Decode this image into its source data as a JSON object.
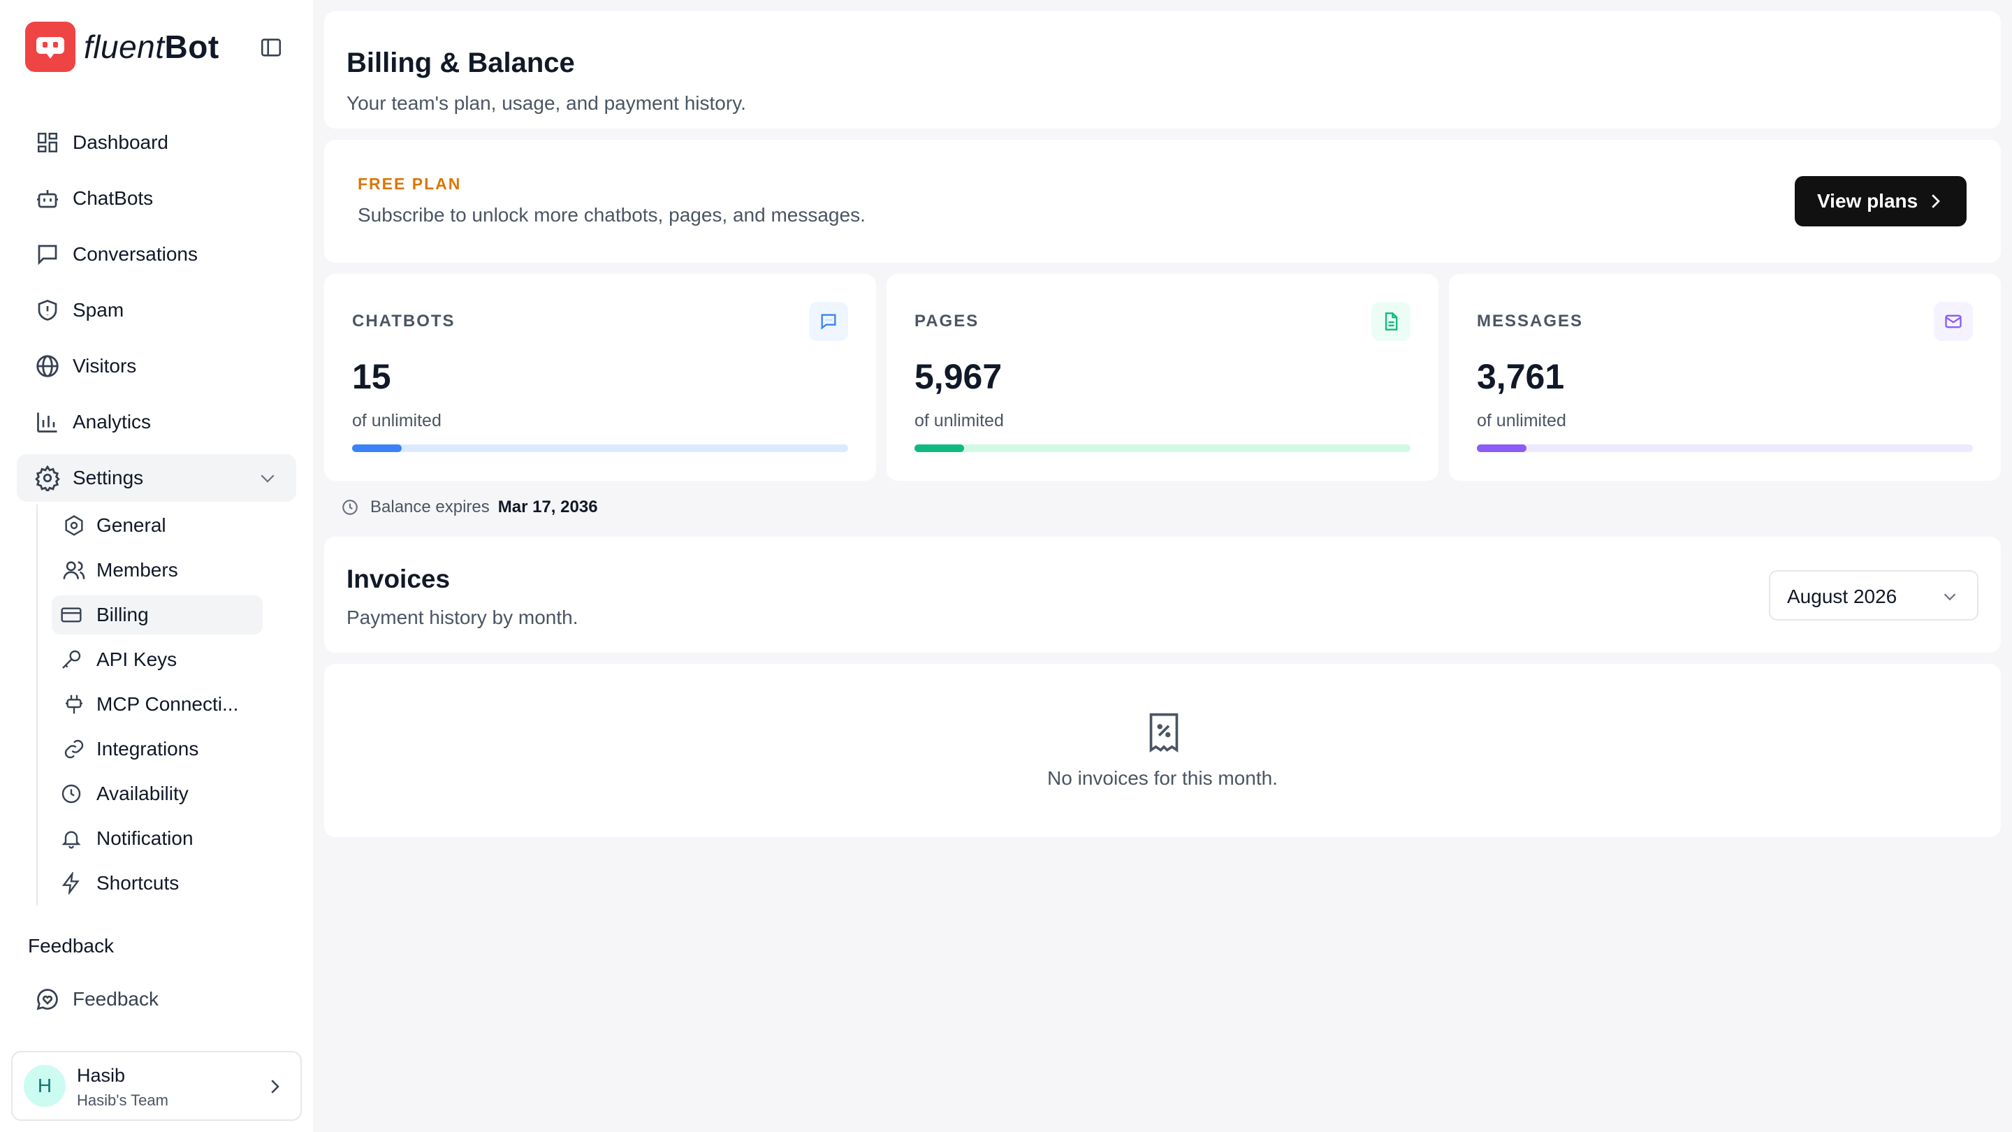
{
  "brand": {
    "name_light": "fluent",
    "name_bold": "Bot"
  },
  "nav": [
    {
      "label": "Dashboard",
      "icon": "dashboard-icon"
    },
    {
      "label": "ChatBots",
      "icon": "bot-icon"
    },
    {
      "label": "Conversations",
      "icon": "chat-bubble-icon"
    },
    {
      "label": "Spam",
      "icon": "shield-alert-icon"
    },
    {
      "label": "Visitors",
      "icon": "globe-icon"
    },
    {
      "label": "Analytics",
      "icon": "bar-chart-icon"
    },
    {
      "label": "Settings",
      "icon": "gear-icon",
      "expanded": true
    }
  ],
  "settings_sub": [
    {
      "label": "General",
      "icon": "hex-settings-icon"
    },
    {
      "label": "Members",
      "icon": "users-icon"
    },
    {
      "label": "Billing",
      "icon": "credit-card-icon",
      "active": true
    },
    {
      "label": "API Keys",
      "icon": "key-icon"
    },
    {
      "label": "MCP Connecti...",
      "icon": "plug-icon"
    },
    {
      "label": "Integrations",
      "icon": "link-icon"
    },
    {
      "label": "Availability",
      "icon": "clock-icon"
    },
    {
      "label": "Notification",
      "icon": "bell-icon"
    },
    {
      "label": "Shortcuts",
      "icon": "bolt-icon"
    }
  ],
  "feedback": {
    "section_title": "Feedback",
    "item_label": "Feedback"
  },
  "user": {
    "initial": "H",
    "name": "Hasib",
    "team": "Hasib's Team"
  },
  "header": {
    "title": "Billing & Balance",
    "subtitle": "Your team's plan, usage, and payment history."
  },
  "plan": {
    "tag": "FREE PLAN",
    "description": "Subscribe to unlock more chatbots, pages, and messages.",
    "button_label": "View plans"
  },
  "stats": [
    {
      "label": "CHATBOTS",
      "value": "15",
      "sub": "of unlimited",
      "progress_pct": 10,
      "color": "#3b82f6",
      "track": "#dbeafe",
      "icon_bg": "#eff6ff"
    },
    {
      "label": "PAGES",
      "value": "5,967",
      "sub": "of unlimited",
      "progress_pct": 10,
      "color": "#10b981",
      "track": "#d1fae5",
      "icon_bg": "#ecfdf5"
    },
    {
      "label": "MESSAGES",
      "value": "3,761",
      "sub": "of unlimited",
      "progress_pct": 10,
      "color": "#8b5cf6",
      "track": "#ede9fe",
      "icon_bg": "#f5f3ff"
    }
  ],
  "balance": {
    "label": "Balance expires",
    "date": "Mar 17, 2036"
  },
  "invoices": {
    "title": "Invoices",
    "subtitle": "Payment history by month.",
    "selected_month": "August 2026",
    "empty_text": "No invoices for this month."
  }
}
